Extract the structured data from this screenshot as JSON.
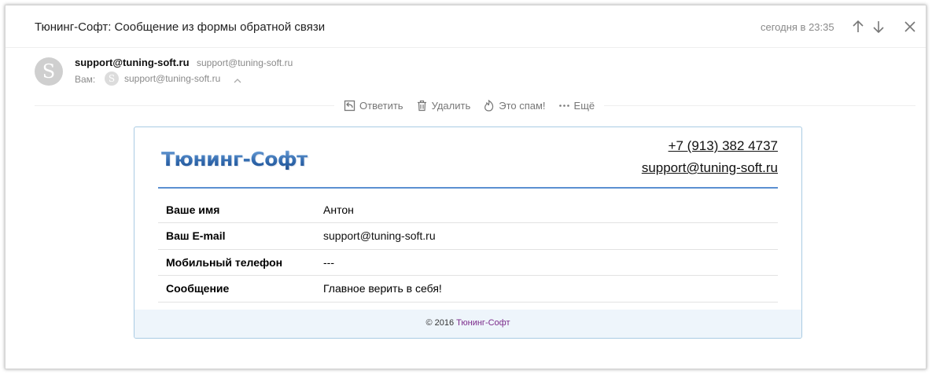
{
  "header": {
    "subject": "Тюнинг-Софт: Сообщение из формы обратной связи",
    "date": "сегодня в 23:35"
  },
  "sender": {
    "avatar_letter": "S",
    "name": "support@tuning-soft.ru",
    "address": "support@tuning-soft.ru",
    "to_label": "Вам:",
    "to_avatar_letter": "S",
    "to_address": "support@tuning-soft.ru"
  },
  "actions": {
    "reply": "Ответить",
    "delete": "Удалить",
    "spam": "Это спам!",
    "more": "Ещё"
  },
  "card": {
    "logo": "Тюнинг-Софт",
    "phone": "+7 (913) 382 4737",
    "email": "support@tuning-soft.ru",
    "rows": [
      {
        "label": "Ваше имя",
        "value": "Антон"
      },
      {
        "label": "Ваш E-mail",
        "value": "support@tuning-soft.ru"
      },
      {
        "label": "Мобильный телефон",
        "value": "---"
      },
      {
        "label": "Сообщение",
        "value": "Главное верить в себя!"
      }
    ],
    "footer_prefix": "© 2016",
    "footer_link": "Тюнинг-Софт"
  },
  "colors": {
    "accent": "#5b8fd1",
    "card_border": "#a9cbe3",
    "footer_bg": "#eef5fb"
  }
}
